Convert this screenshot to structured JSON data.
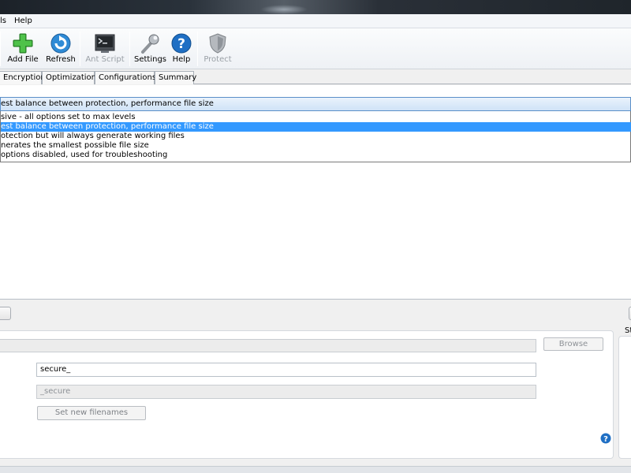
{
  "menu": {
    "tools_fragment": "ls",
    "help": "Help"
  },
  "toolbar": {
    "add_file": "Add File",
    "refresh": "Refresh",
    "ant_script": "Ant Script",
    "settings": "Settings",
    "help": "Help",
    "protect": "Protect"
  },
  "tabs": [
    {
      "label": "Encryption"
    },
    {
      "label": "Optimization"
    },
    {
      "label": "Configurations"
    },
    {
      "label": "Summary"
    }
  ],
  "profile_combo": {
    "selected_value": "est balance between protection, performance file size"
  },
  "profile_options": [
    {
      "label": "sive - all options set to max levels",
      "selected": false
    },
    {
      "label": "est balance between protection, performance file size",
      "selected": true
    },
    {
      "label": "otection but will always generate working files",
      "selected": false
    },
    {
      "label": "nerates the smallest possible file size",
      "selected": false
    },
    {
      "label": "options disabled, used for troubleshooting",
      "selected": false
    }
  ],
  "output": {
    "browse_label": "Browse",
    "prefix_value": "secure_",
    "suffix_value": "_secure",
    "set_filenames_label": "Set new filenames",
    "right_panel_label": "St"
  },
  "colors": {
    "selection": "#3399ff",
    "combo_border": "#5b8fc8",
    "help_blue": "#1f6fc4",
    "add_green": "#3aa335"
  }
}
